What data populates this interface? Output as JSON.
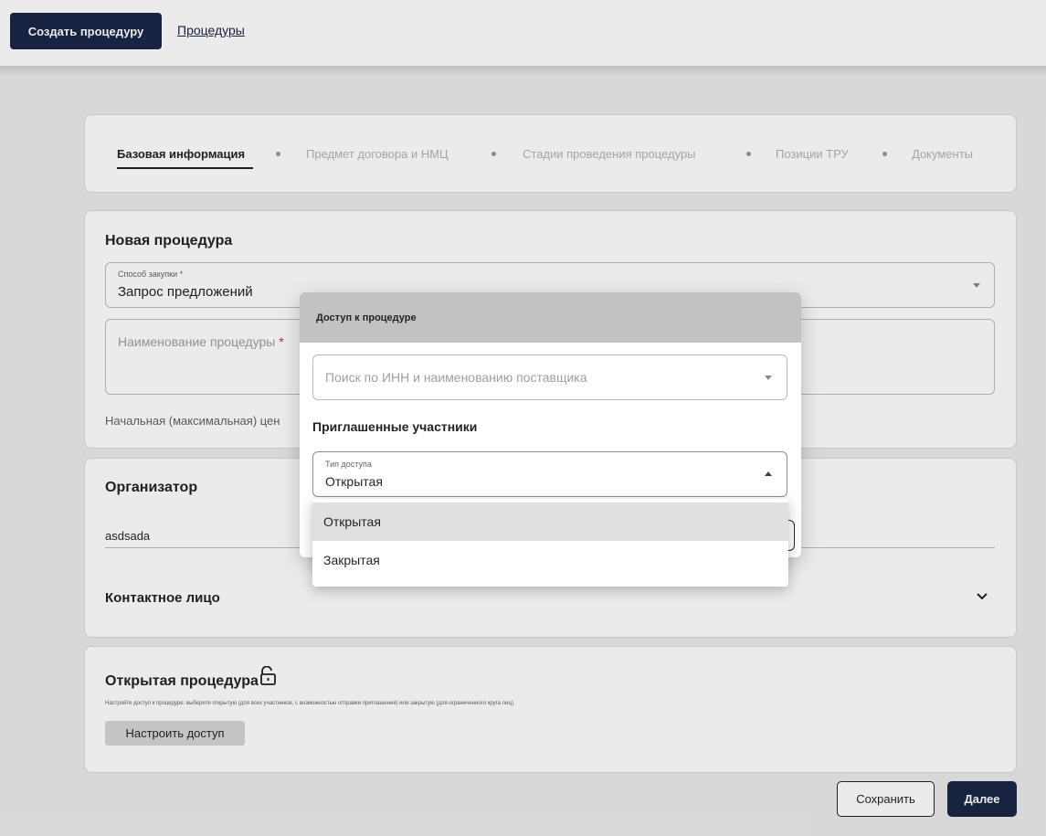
{
  "topbar": {
    "create_button": "Создать процедуру",
    "procedures_link": "Процедуры"
  },
  "stepper": {
    "steps": [
      "Базовая информация",
      "Предмет договора и НМЦ",
      "Стадии проведения процедуры",
      "Позиции ТРУ",
      "Документы"
    ],
    "active_index": 0
  },
  "new_procedure": {
    "title": "Новая процедура",
    "method_label": "Способ закупки",
    "method_value": "Запрос предложений",
    "name_placeholder": "Наименование процедуры",
    "required_mark": "*",
    "nmc_label": "Начальная (максимальная) цен"
  },
  "organizer": {
    "title": "Организатор",
    "value": "asdsada",
    "contact_title": "Контактное лицо"
  },
  "open_procedure": {
    "title": "Открытая процедура",
    "hint": "Настройте доступ к процедуре: выберите открытую (для всех участников, с возможностью отправки приглашения) или закрытую (для ограниченного круга лиц).",
    "access_button": "Настроить доступ"
  },
  "footer": {
    "save_button": "Сохранить",
    "next_button": "Далее"
  },
  "modal": {
    "title": "Доступ к процедуре",
    "search_placeholder": "Поиск по ИНН и наименованию поставщика",
    "invited_title": "Приглашенные участники",
    "access_type_label": "Тип доступа",
    "access_type_value": "Открытая",
    "options": [
      "Открытая",
      "Закрытая"
    ],
    "selected_option": "Открытая"
  },
  "colors": {
    "primary": "#1b2547",
    "required": "#d93025",
    "modal_header": "#c2c2c2"
  }
}
